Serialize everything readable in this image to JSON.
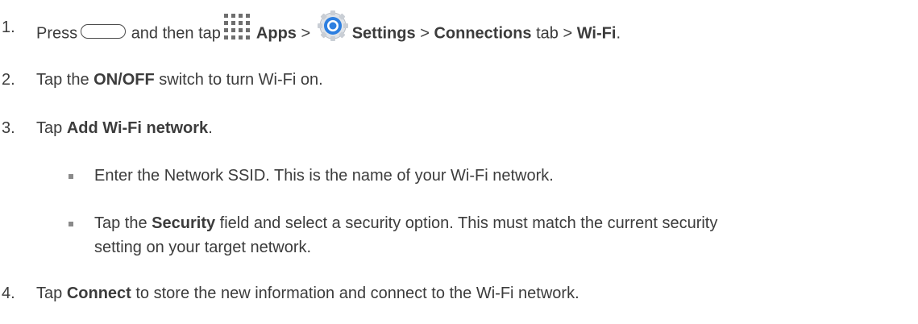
{
  "steps": [
    {
      "number": "1.",
      "segments": {
        "press": "Press",
        "and_then_tap": "and then tap",
        "apps": "Apps",
        "sep1": ">",
        "settings": "Settings",
        "sep2": ">",
        "connections": "Connections",
        "tab_sep": "tab >",
        "wifi": "Wi-Fi",
        "end": "."
      },
      "icons": [
        "home-button-icon",
        "apps-grid-icon",
        "settings-gear-icon"
      ]
    },
    {
      "number": "2.",
      "segments": {
        "tap": "Tap the",
        "onoff": "ON/OFF",
        "rest": "switch to turn Wi-Fi on."
      }
    },
    {
      "number": "3.",
      "segments": {
        "tap": "Tap",
        "add": "Add Wi-Fi network",
        "end": "."
      },
      "bullets": [
        {
          "text": "Enter the Network SSID. This is the name of your Wi-Fi network."
        },
        {
          "pre": "Tap the",
          "security": "Security",
          "line1_rest": "field and select a security option. This must match the current security",
          "line2": "setting on your target network."
        }
      ]
    },
    {
      "number": "4.",
      "segments": {
        "tap": "Tap",
        "connect": "Connect",
        "rest": "to store the new information and connect to the Wi-Fi network."
      }
    }
  ],
  "colors": {
    "text": "#3c3c3c",
    "bullet": "#8a8a8a",
    "gear_blue": "#2d7fe0"
  }
}
